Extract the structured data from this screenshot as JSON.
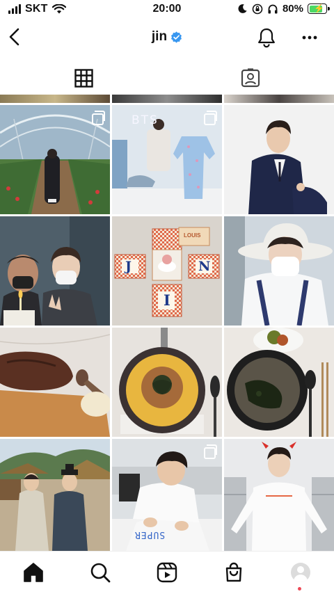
{
  "status_bar": {
    "carrier": "SKT",
    "time": "20:00",
    "battery_percent": "80%",
    "battery_level": 0.8,
    "icons": [
      "signal-icon",
      "wifi-icon",
      "moon-icon",
      "orientation-lock-icon",
      "headphones-icon",
      "battery-icon"
    ]
  },
  "header": {
    "title": "jin",
    "verified": true,
    "icons": [
      "back-chevron-icon",
      "verified-badge-icon",
      "bell-icon",
      "more-dots-icon"
    ]
  },
  "tabs": [
    {
      "name": "posts",
      "icon": "grid-icon",
      "active": true
    },
    {
      "name": "tagged",
      "icon": "tagged-person-icon",
      "active": false
    }
  ],
  "grid": {
    "posts": [
      {
        "description": "strawberry-greenhouse",
        "multi": true,
        "caption": ""
      },
      {
        "description": "bts-pajama-merch",
        "multi": true,
        "caption": "BTS"
      },
      {
        "description": "portrait-navy-suit",
        "multi": false,
        "caption": ""
      },
      {
        "description": "selfie-with-friend-candle",
        "multi": false,
        "caption": ""
      },
      {
        "description": "birthday-cake-box",
        "multi": false,
        "caption": "LOUIS",
        "letters": [
          "J",
          "I",
          "N"
        ]
      },
      {
        "description": "white-hat-selfie",
        "multi": false,
        "caption": ""
      },
      {
        "description": "steak-dinner",
        "multi": false,
        "caption": ""
      },
      {
        "description": "pan-dish",
        "multi": false,
        "caption": ""
      },
      {
        "description": "bowl-soup",
        "multi": false,
        "caption": ""
      },
      {
        "description": "historical-village",
        "multi": false,
        "caption": ""
      },
      {
        "description": "signing-shirt",
        "multi": true,
        "caption": "SUPER"
      },
      {
        "description": "white-longsleeve-pose",
        "multi": false,
        "caption": ""
      }
    ]
  },
  "bottom_nav": {
    "items": [
      {
        "name": "home",
        "icon": "home-icon",
        "active": true
      },
      {
        "name": "search",
        "icon": "search-icon",
        "active": false
      },
      {
        "name": "reels",
        "icon": "reels-icon",
        "active": false
      },
      {
        "name": "shop",
        "icon": "shop-bag-icon",
        "active": false
      },
      {
        "name": "profile",
        "icon": "profile-avatar-icon",
        "active": false
      }
    ]
  },
  "colors": {
    "verified": "#3897f0",
    "battery_fill": "#4cd964",
    "notification_dot": "#ed4956"
  }
}
